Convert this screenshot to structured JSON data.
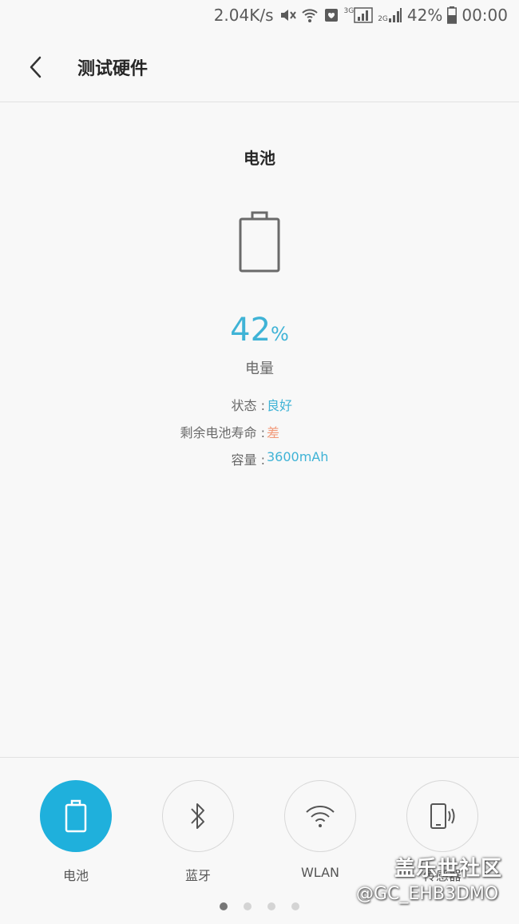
{
  "status_bar": {
    "speed": "2.04K/s",
    "net1": "3G",
    "net2": "2G",
    "battery_pct": "42%",
    "time": "00:00"
  },
  "header": {
    "title": "测试硬件"
  },
  "section": {
    "title": "电池"
  },
  "battery": {
    "percent_value": "42",
    "percent_unit": "%",
    "label": "电量",
    "status_key": "状态 : ",
    "status_value": "良好",
    "life_key": "剩余电池寿命 : ",
    "life_value": "差",
    "capacity_key": "容量 : ",
    "capacity_value": "3600mAh"
  },
  "nav": {
    "items": [
      {
        "label": "电池",
        "icon": "battery-icon",
        "active": true
      },
      {
        "label": "蓝牙",
        "icon": "bluetooth-icon",
        "active": false
      },
      {
        "label": "WLAN",
        "icon": "wifi-icon",
        "active": false
      },
      {
        "label": "传感器",
        "icon": "vibrate-phone-icon",
        "active": false
      }
    ],
    "pages": 4,
    "current_page": 1
  },
  "watermark": {
    "line1": "盖乐世社区",
    "line2": "@GC_EHB3DMO"
  },
  "colors": {
    "accent": "#1fb0dc",
    "value_blue": "#3fb3d6",
    "value_orange": "#f29a7a"
  }
}
